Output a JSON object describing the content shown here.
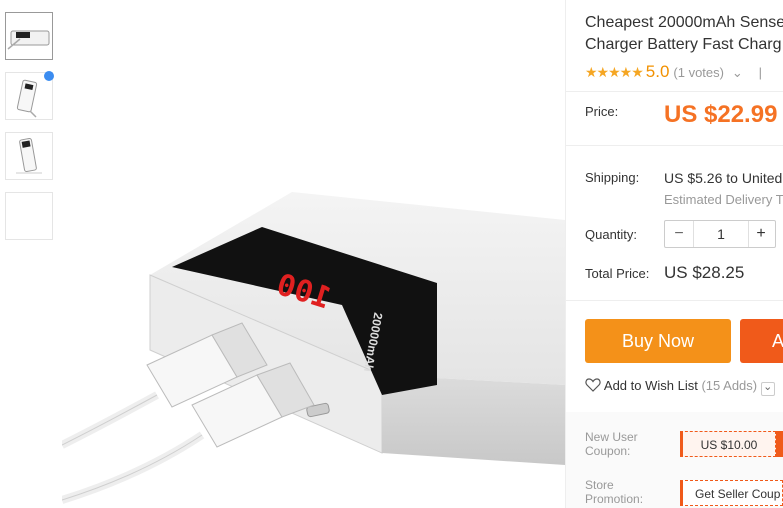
{
  "thumbnails": [
    {
      "name": "thumbnail-1"
    },
    {
      "name": "thumbnail-2"
    },
    {
      "name": "thumbnail-3"
    },
    {
      "name": "thumbnail-4"
    }
  ],
  "product_image": {
    "display_text": "100",
    "capacity_text": "20000mAh"
  },
  "product": {
    "title_line1": "Cheapest 20000mAh Sense",
    "title_line2": "Charger Battery Fast Charg",
    "stars": "★★★★★",
    "rating": "5.0",
    "votes": "(1 votes)",
    "votes_chevron": "⌄",
    "rating_sep": "|"
  },
  "price": {
    "label": "Price:",
    "value": "US $22.99"
  },
  "shipping": {
    "label": "Shipping:",
    "value_amount": "US $5.26",
    "value_rest": " to United",
    "estimated": "Estimated Delivery T"
  },
  "quantity": {
    "label": "Quantity:",
    "minus": "−",
    "value": "1",
    "plus": "+"
  },
  "total": {
    "label": "Total Price:",
    "value": "US $28.25"
  },
  "actions": {
    "buy_now": "Buy Now",
    "add_to_cart": "A"
  },
  "wishlist": {
    "label": "Add to Wish List",
    "count": "(15 Adds)",
    "chevron": "⌄"
  },
  "coupons": {
    "new_user_label_line1": "New User",
    "new_user_label_line2": "Coupon:",
    "new_user_value": "US $10.00",
    "store_label_line1": "Store",
    "store_label_line2": "Promotion:",
    "store_value": "Get Seller Coup"
  },
  "colors": {
    "accent_orange": "#f49119",
    "accent_red": "#f05a1a",
    "price_orange": "#f57224",
    "star_yellow": "#f5a623"
  }
}
